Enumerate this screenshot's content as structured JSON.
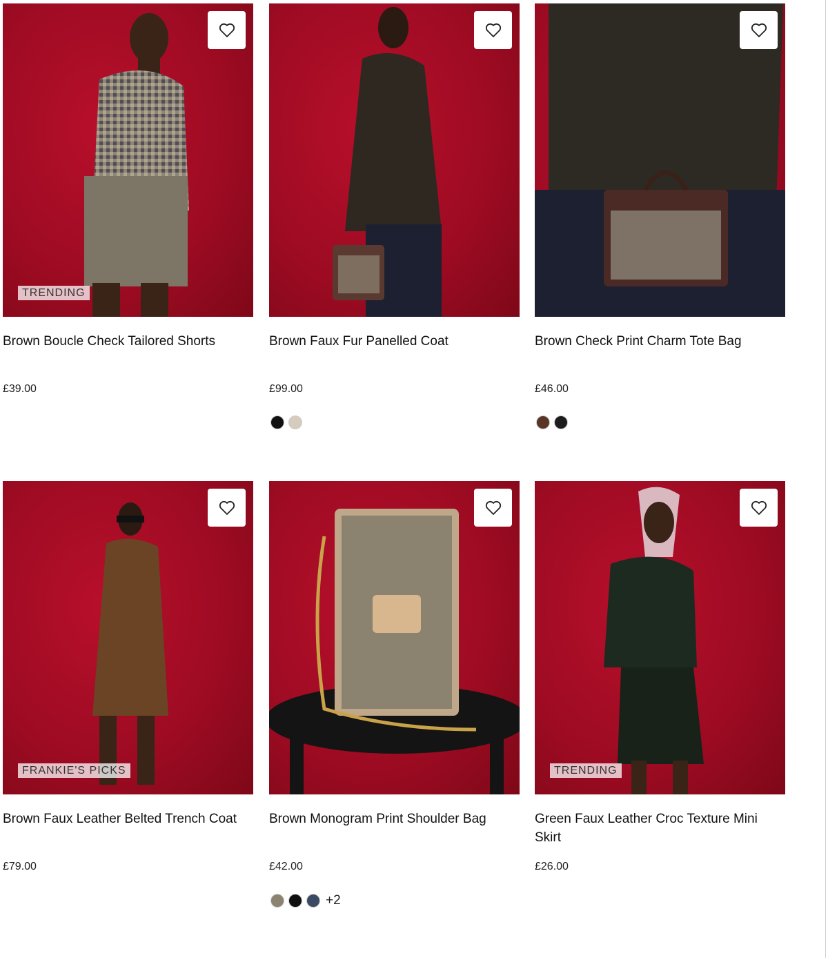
{
  "products": [
    {
      "title": "Brown Boucle Check Tailored Shorts",
      "price": "£39.00",
      "badge": "TRENDING",
      "swatches": []
    },
    {
      "title": "Brown Faux Fur Panelled Coat",
      "price": "£99.00",
      "badge": "",
      "swatches": [
        "#111111",
        "#d6ccbd"
      ]
    },
    {
      "title": "Brown Check Print Charm Tote Bag",
      "price": "£46.00",
      "badge": "",
      "swatches": [
        "#5a3526",
        "#1c1c1c"
      ]
    },
    {
      "title": "Brown Faux Leather Belted Trench Coat",
      "price": "£79.00",
      "badge": "FRANKIE'S PICKS",
      "swatches": []
    },
    {
      "title": "Brown Monogram Print Shoulder Bag",
      "price": "£42.00",
      "badge": "",
      "swatches": [
        "#8b8370",
        "#0f0f0f",
        "#3b4a63"
      ],
      "more_swatches": "+2"
    },
    {
      "title": "Green Faux Leather Croc Texture Mini Skirt",
      "price": "£26.00",
      "badge": "TRENDING",
      "swatches": []
    }
  ],
  "icons": {
    "wishlist": "heart-outline-icon"
  },
  "colors": {
    "background_red": "#a30d26",
    "text": "#111111"
  }
}
